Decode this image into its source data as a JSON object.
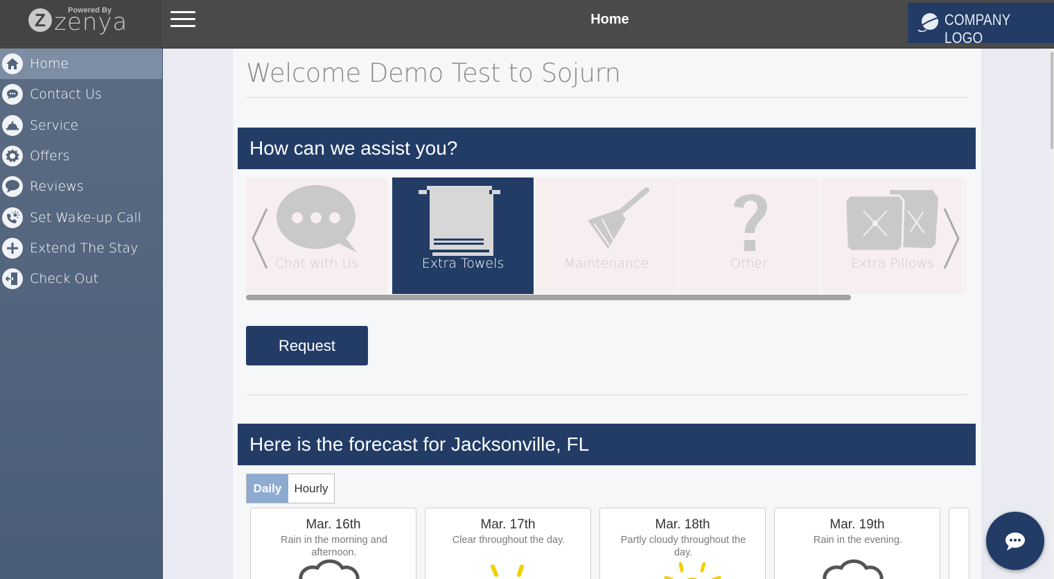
{
  "brand": {
    "powered_by": "Powered By",
    "name": "zenya",
    "mark": "Z"
  },
  "header": {
    "title": "Home",
    "company_logo": "COMPANY LOGO"
  },
  "sidebar": {
    "items": [
      {
        "label": "Home",
        "icon": "home-icon",
        "active": true
      },
      {
        "label": "Contact Us",
        "icon": "chat-bubble-icon",
        "active": false
      },
      {
        "label": "Service",
        "icon": "service-bell-icon",
        "active": false
      },
      {
        "label": "Offers",
        "icon": "badge-icon",
        "active": false
      },
      {
        "label": "Reviews",
        "icon": "speech-bubble-icon",
        "active": false
      },
      {
        "label": "Set Wake-up Call",
        "icon": "phone-sun-icon",
        "active": false
      },
      {
        "label": "Extend The Stay",
        "icon": "plus-icon",
        "active": false
      },
      {
        "label": "Check Out",
        "icon": "exit-door-icon",
        "active": false
      }
    ]
  },
  "main": {
    "welcome": "Welcome Demo Test to Sojurn",
    "assist": {
      "heading": "How can we assist you?",
      "options": [
        {
          "label": "Chat with Us",
          "icon": "chat-dots-icon",
          "selected": false
        },
        {
          "label": "Extra Towels",
          "icon": "towel-icon",
          "selected": true
        },
        {
          "label": "Maintenance",
          "icon": "broom-icon",
          "selected": false
        },
        {
          "label": "Other",
          "icon": "question-icon",
          "selected": false
        },
        {
          "label": "Extra Pillows",
          "icon": "pillow-icon",
          "selected": false
        }
      ],
      "request_button": "Request"
    },
    "forecast": {
      "heading": "Here is the forecast for Jacksonville, FL",
      "tabs": {
        "daily": "Daily",
        "hourly": "Hourly",
        "active": "Daily"
      },
      "days": [
        {
          "date": "Mar. 16th",
          "desc": "Rain in the morning and afternoon.",
          "icon": "cloud-rain-icon"
        },
        {
          "date": "Mar. 17th",
          "desc": "Clear throughout the day.",
          "icon": "sun-icon"
        },
        {
          "date": "Mar. 18th",
          "desc": "Partly cloudy throughout the day.",
          "icon": "partly-cloudy-icon"
        },
        {
          "date": "Mar. 19th",
          "desc": "Rain in the evening.",
          "icon": "cloud-rain-icon"
        }
      ]
    }
  },
  "colors": {
    "navy": "#223c66",
    "sidebar": "#52647c",
    "active_tab": "#8daad0"
  }
}
